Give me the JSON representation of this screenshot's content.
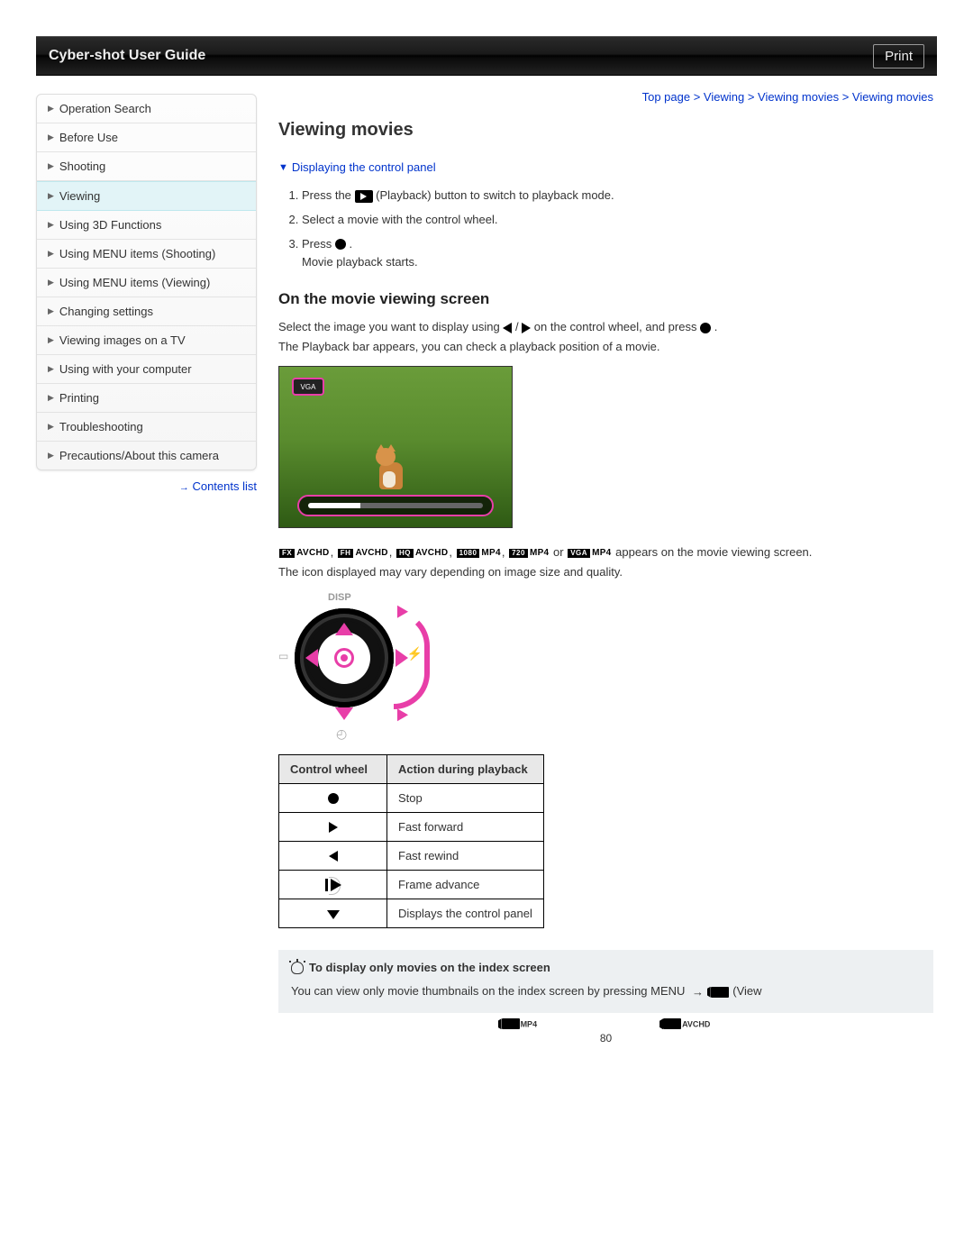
{
  "header": {
    "title": "Cyber-shot User Guide",
    "print_label": "Print"
  },
  "sidebar": {
    "items": [
      {
        "label": "Operation Search"
      },
      {
        "label": "Before Use"
      },
      {
        "label": "Shooting"
      },
      {
        "label": "Viewing"
      },
      {
        "label": "Using 3D Functions"
      },
      {
        "label": "Using MENU items (Shooting)"
      },
      {
        "label": "Using MENU items (Viewing)"
      },
      {
        "label": "Changing settings"
      },
      {
        "label": "Viewing images on a TV"
      },
      {
        "label": "Using with your computer"
      },
      {
        "label": "Printing"
      },
      {
        "label": "Troubleshooting"
      },
      {
        "label": "Precautions/About this camera"
      }
    ],
    "contents_list": "Contents list"
  },
  "breadcrumb": "Top page > Viewing > Viewing movies > Viewing movies",
  "title": "Viewing movies",
  "anchor_link": "Displaying the control panel",
  "steps": {
    "s1a": "Press the ",
    "s1b": " (Playback) button to switch to playback mode.",
    "s2": "Select a movie with the control wheel.",
    "s3a": "Press ",
    "s3b": " .",
    "s3c": "Movie playback starts."
  },
  "section2_title": "On the movie viewing screen",
  "p1a": "Select the image you want to display using ",
  "p1b": " on the control wheel, and press ",
  "p1c": " .",
  "p2": "The Playback bar appears, you can check a playback position of a movie.",
  "vga_label": "VGA",
  "formats": {
    "f1": {
      "tag": "FX",
      "label": "AVCHD"
    },
    "f2": {
      "tag": "FH",
      "label": "AVCHD"
    },
    "f3": {
      "tag": "HQ",
      "label": "AVCHD"
    },
    "f4": {
      "tag": "1080",
      "label": "MP4"
    },
    "f5": {
      "tag": "720",
      "label": "MP4"
    },
    "f6": {
      "tag": "VGA",
      "label": "MP4"
    }
  },
  "format_line_mid": " or ",
  "format_line_end": " appears on the movie viewing screen.",
  "p3": "The icon displayed may vary depending on image size and quality.",
  "cw_disp": "DISP",
  "table": {
    "h1": "Control wheel",
    "h2": "Action during playback",
    "r1": "Stop",
    "r2": "Fast forward",
    "r3": "Fast rewind",
    "r4": "Frame advance",
    "r5": "Displays the control panel"
  },
  "tip": {
    "title": "To display only movies on the index screen",
    "line1a": "You can view only movie thumbnails on the index screen by pressing MENU ",
    "line1b": " (View"
  },
  "bottom_formats": {
    "a": "MP4",
    "b": "AVCHD"
  },
  "page_number": "80"
}
